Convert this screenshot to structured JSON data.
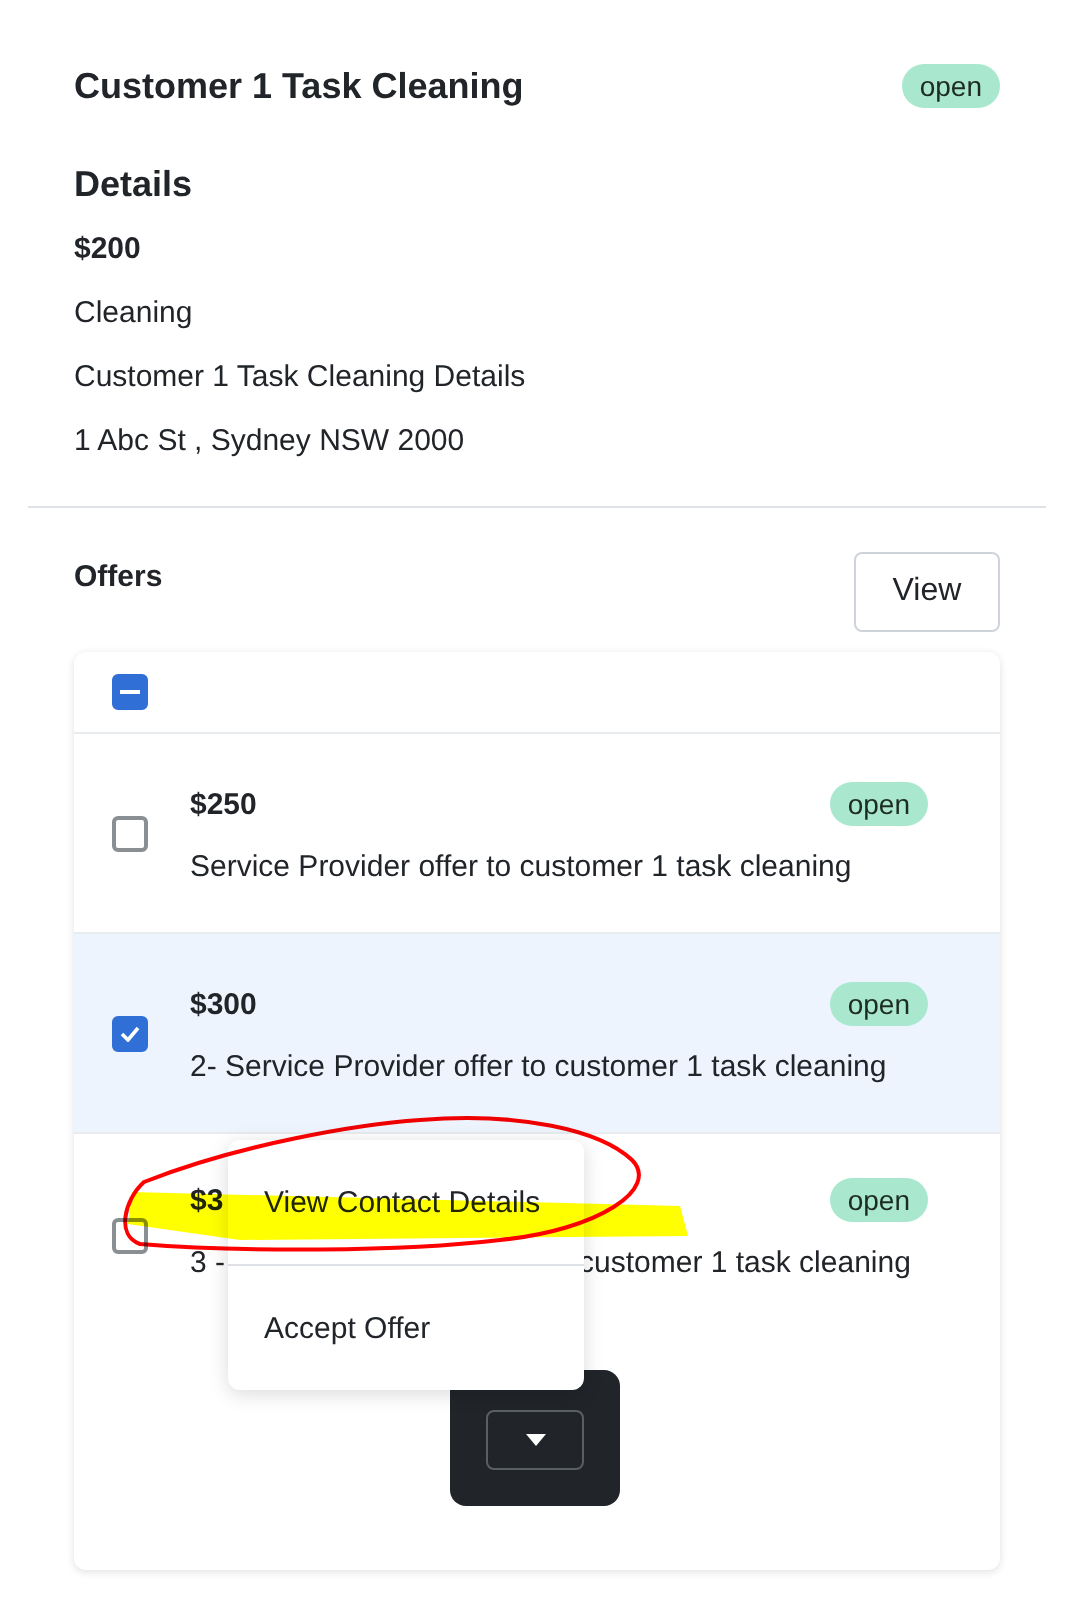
{
  "task": {
    "title": "Customer 1 Task Cleaning",
    "status": "open"
  },
  "details": {
    "heading": "Details",
    "price": "$200",
    "category": "Cleaning",
    "description": "Customer 1 Task Cleaning Details",
    "address": "1 Abc St , Sydney NSW 2000"
  },
  "offers": {
    "heading": "Offers",
    "view_button": "View",
    "select_all": {
      "indeterminate": true
    },
    "rows": [
      {
        "price": "$250",
        "status": "open",
        "description_parts": [
          "Service Provider offer to customer 1 task cleaning"
        ],
        "checked": false
      },
      {
        "price": "$300",
        "status": "open",
        "description_parts": [
          "2- Service Provider offer to customer 1 task cleaning"
        ],
        "checked": true
      },
      {
        "price": "$3",
        "status": "open",
        "description_parts": [
          "3 -",
          "customer 1 task cleaning"
        ],
        "checked": false
      }
    ],
    "menu": {
      "expanded": true,
      "items": [
        "View Contact Details",
        "Accept Offer"
      ]
    }
  },
  "annotations": [
    {
      "kind": "highlight",
      "color": "#ffff00"
    },
    {
      "kind": "circle",
      "color": "#ff0000"
    }
  ]
}
